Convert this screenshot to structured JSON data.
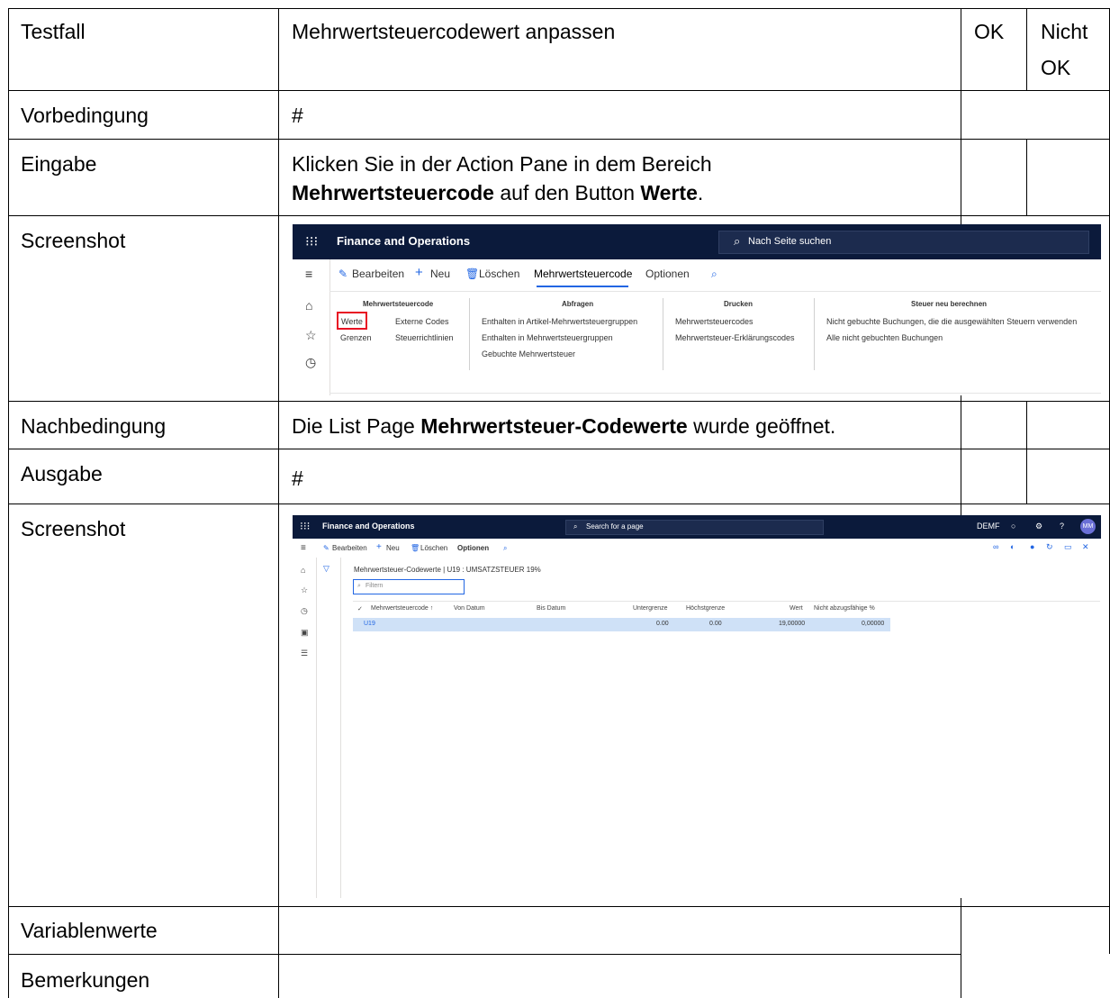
{
  "table": {
    "rows": {
      "testfall": {
        "label": "Testfall",
        "value": "Mehrwertsteuercodewert anpassen",
        "ok": "OK",
        "nicht_ok_1": "Nicht",
        "nicht_ok_2": "OK"
      },
      "vorbedingung": {
        "label": "Vorbedingung",
        "value": "#"
      },
      "eingabe": {
        "label": "Eingabe",
        "line1": "Klicken Sie in der Action Pane in dem Bereich",
        "bold1": "Mehrwertsteuercode",
        "mid": " auf den Button ",
        "bold2": "Werte",
        "end": "."
      },
      "screenshot1": {
        "label": "Screenshot"
      },
      "nachbedingung": {
        "label": "Nachbedingung",
        "pre": "Die List Page ",
        "bold": "Mehrwertsteuer-Codewerte",
        "post": " wurde geöffnet."
      },
      "ausgabe": {
        "label": "Ausgabe",
        "value": "#"
      },
      "screenshot2": {
        "label": "Screenshot"
      },
      "variablenwerte": {
        "label": "Variablenwerte"
      },
      "bemerkungen": {
        "label": "Bemerkungen"
      }
    }
  },
  "shot1": {
    "app_title": "Finance and Operations",
    "search_placeholder": "Nach Seite suchen",
    "toolbar": {
      "edit": "Bearbeiten",
      "new": "Neu",
      "delete": "Löschen",
      "tab_active": "Mehrwertsteuercode",
      "tab_options": "Optionen"
    },
    "groups": {
      "g1": {
        "title": "Mehrwertsteuercode",
        "items": [
          "Werte",
          "Externe Codes",
          "Grenzen",
          "Steuerrichtlinien"
        ]
      },
      "g2": {
        "title": "Abfragen",
        "items": [
          "Enthalten in Artikel-Mehrwertsteuergruppen",
          "Enthalten in Mehrwertsteuergruppen",
          "Gebuchte Mehrwertsteuer"
        ]
      },
      "g3": {
        "title": "Drucken",
        "items": [
          "Mehrwertsteuercodes",
          "Mehrwertsteuer-Erklärungscodes"
        ]
      },
      "g4": {
        "title": "Steuer neu berechnen",
        "items": [
          "Nicht gebuchte Buchungen, die die ausgewählten Steuern verwenden",
          "Alle nicht gebuchten Buchungen"
        ]
      }
    }
  },
  "shot2": {
    "app_title": "Finance and Operations",
    "search_placeholder": "Search for a page",
    "company": "DEMF",
    "avatar": "MM",
    "toolbar": {
      "edit": "Bearbeiten",
      "new": "Neu",
      "delete": "Löschen",
      "options": "Optionen"
    },
    "breadcrumb": "Mehrwertsteuer-Codewerte | U19 : UMSATZSTEUER 19%",
    "filter_placeholder": "Filtern",
    "columns": [
      "Mehrwertsteuercode ↑",
      "Von Datum",
      "Bis Datum",
      "Untergrenze",
      "Höchstgrenze",
      "Wert",
      "Nicht abzugsfähige %"
    ],
    "rows": [
      {
        "code": "U19",
        "von": "",
        "bis": "",
        "unter": "0.00",
        "hoechst": "0.00",
        "wert": "19,00000",
        "nicht_abz": "0,00000"
      }
    ]
  }
}
